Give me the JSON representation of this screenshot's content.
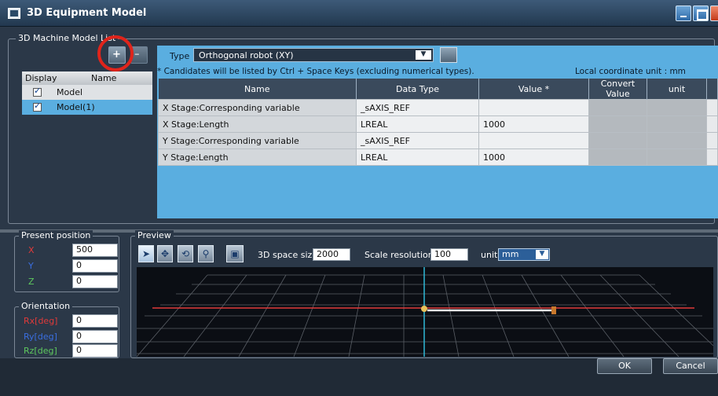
{
  "window": {
    "title": "3D Equipment Model"
  },
  "machine_list": {
    "group_label": "3D Machine Model List",
    "columns": [
      "Display",
      "Name"
    ],
    "rows": [
      {
        "name": "Model",
        "checked": true
      },
      {
        "name": "Model(1)",
        "checked": true
      }
    ]
  },
  "type_panel": {
    "type_label": "Type",
    "type_value": "Orthogonal robot (XY)",
    "candidates_note": "* Candidates will be listed by Ctrl + Space Keys (excluding numerical types).",
    "local_unit": "Local coordinate unit : mm"
  },
  "param_table": {
    "columns": [
      "Name",
      "Data Type",
      "Value *",
      "Convert Value",
      "unit"
    ],
    "rows": [
      {
        "name": "X Stage:Corresponding variable",
        "type": "_sAXIS_REF",
        "value": ""
      },
      {
        "name": "X Stage:Length",
        "type": "LREAL",
        "value": "1000"
      },
      {
        "name": "Y Stage:Corresponding variable",
        "type": "_sAXIS_REF",
        "value": ""
      },
      {
        "name": "Y Stage:Length",
        "type": "LREAL",
        "value": "1000"
      }
    ]
  },
  "present_position": {
    "label": "Present position",
    "x_label": "X",
    "x_value": "500",
    "y_label": "Y",
    "y_value": "0",
    "z_label": "Z",
    "z_value": "0",
    "colors": {
      "x": "#e03a3a",
      "y": "#3a6ee0",
      "z": "#5ec85e"
    }
  },
  "orientation": {
    "label": "Orientation",
    "rx_label": "Rx[deg]",
    "rx_value": "0",
    "ry_label": "Ry[deg]",
    "ry_value": "0",
    "rz_label": "Rz[deg]",
    "rz_value": "0"
  },
  "preview": {
    "label": "Preview",
    "space_size_label": "3D space size",
    "space_size_value": "2000",
    "scale_label": "Scale resolution",
    "scale_value": "100",
    "unit_label": "unit",
    "unit_value": "mm",
    "tools": [
      "select-arrow-icon",
      "pan-icon",
      "rotate-icon",
      "zoom-icon",
      "3d-view-icon"
    ]
  },
  "footer": {
    "ok_label": "OK",
    "cancel_label": "Cancel"
  }
}
